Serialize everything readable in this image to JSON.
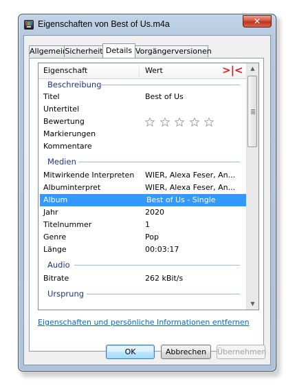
{
  "window": {
    "title": "Eigenschaften von Best of Us.m4a",
    "close_label": "✕"
  },
  "tabs": [
    {
      "label": "Allgemein",
      "active": false
    },
    {
      "label": "Sicherheit",
      "active": false
    },
    {
      "label": "Details",
      "active": true
    },
    {
      "label": "Vorgängerversionen",
      "active": false
    }
  ],
  "list": {
    "col_property": "Eigenschaft",
    "col_value": "Wert",
    "resize_marker": ">|<",
    "groups": {
      "beschreibung": "Beschreibung",
      "medien": "Medien",
      "audio": "Audio",
      "ursprung": "Ursprung"
    },
    "rows": {
      "titel": {
        "p": "Titel",
        "v": "Best of Us"
      },
      "untertitel": {
        "p": "Untertitel",
        "v": ""
      },
      "bewertung": {
        "p": "Bewertung",
        "stars": 0,
        "max_stars": 5
      },
      "markierungen": {
        "p": "Markierungen",
        "v": ""
      },
      "kommentare": {
        "p": "Kommentare",
        "v": ""
      },
      "interpreten": {
        "p": "Mitwirkende Interpreten",
        "v": "WIER, Alexa Feser, An..."
      },
      "albuminterpret": {
        "p": "Albuminterpret",
        "v": "WIER, Alexa Feser, An..."
      },
      "album": {
        "p": "Album",
        "v": "Best of Us - Single",
        "selected": true
      },
      "jahr": {
        "p": "Jahr",
        "v": "2020"
      },
      "titelnummer": {
        "p": "Titelnummer",
        "v": "1"
      },
      "genre": {
        "p": "Genre",
        "v": "Pop"
      },
      "laenge": {
        "p": "Länge",
        "v": "00:03:17"
      },
      "bitrate": {
        "p": "Bitrate",
        "v": "262 kBit/s"
      }
    }
  },
  "link": "Eigenschaften und persönliche Informationen entfernen",
  "buttons": {
    "ok": "OK",
    "cancel": "Abbrechen",
    "apply": "Übernehmen"
  },
  "colors": {
    "selection": "#3399ff",
    "group_text": "#1e3287",
    "link": "#0066cc",
    "marker": "#e01b1b"
  }
}
